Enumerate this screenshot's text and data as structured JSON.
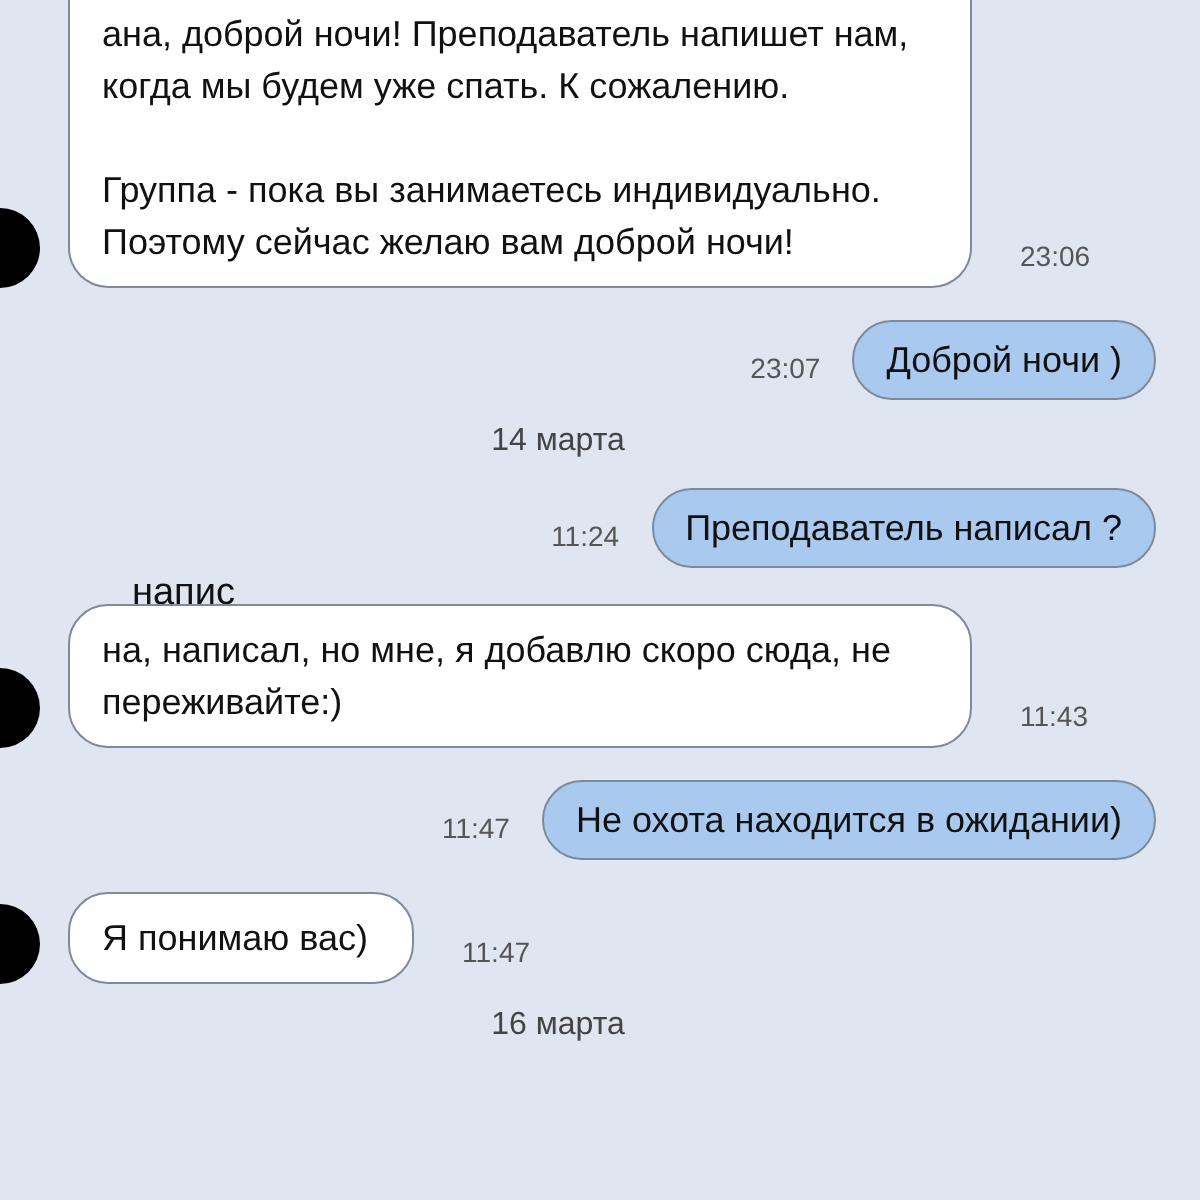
{
  "messages": [
    {
      "kind": "incoming",
      "paragraphs": [
        [
          "ана, доброй ночи! Преподаватель напишет нам, когда мы будем уже спать. К сожалению."
        ],
        [
          "Группа - пока вы занимаетесь индивидуально.",
          "Поэтому сейчас желаю вам доброй ночи!"
        ]
      ],
      "time": "23:06",
      "avatar": true
    },
    {
      "kind": "outgoing",
      "lines": [
        "Доброй ночи )"
      ],
      "time": "23:07"
    },
    {
      "kind": "date",
      "text": "14 марта"
    },
    {
      "kind": "outgoing",
      "lines": [
        "Преподаватель написал ?"
      ],
      "time": "11:24"
    },
    {
      "kind": "fragment",
      "text": "напис"
    },
    {
      "kind": "incoming",
      "paragraphs": [
        [
          "на, написал, но мне, я добавлю скоро сюда, не переживайте:)"
        ]
      ],
      "time": "11:43",
      "avatar": true
    },
    {
      "kind": "outgoing",
      "lines": [
        "Не охота находится в ожидании)"
      ],
      "time": "11:47"
    },
    {
      "kind": "incoming",
      "paragraphs": [
        [
          "Я понимаю вас)"
        ]
      ],
      "time": "11:47",
      "avatar": true
    },
    {
      "kind": "date",
      "text": "16 марта"
    }
  ]
}
